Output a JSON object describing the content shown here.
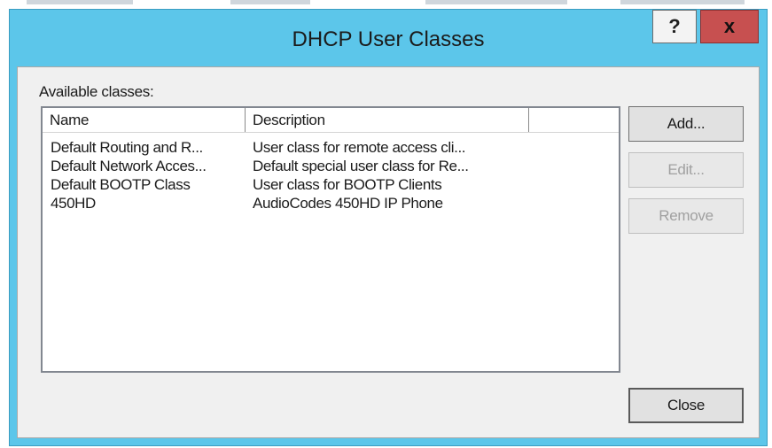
{
  "window": {
    "title": "DHCP User Classes",
    "help_glyph": "?",
    "close_glyph": "x"
  },
  "available_label": "Available classes:",
  "list": {
    "columns": [
      "Name",
      "Description",
      ""
    ],
    "rows": [
      {
        "name": "Default Routing and R...",
        "description": "User class for remote access cli..."
      },
      {
        "name": "Default Network Acces...",
        "description": "Default special user class for Re..."
      },
      {
        "name": "Default BOOTP Class",
        "description": "User class for BOOTP Clients"
      },
      {
        "name": "450HD",
        "description": "AudioCodes 450HD IP Phone"
      }
    ]
  },
  "buttons": {
    "add": "Add...",
    "edit": "Edit...",
    "remove": "Remove",
    "close": "Close"
  },
  "icons": {
    "help": "help-icon",
    "close": "close-icon"
  },
  "colors": {
    "titlebar": "#5cc6ea",
    "close_button": "#c75050",
    "client_bg": "#f0f0f0"
  }
}
